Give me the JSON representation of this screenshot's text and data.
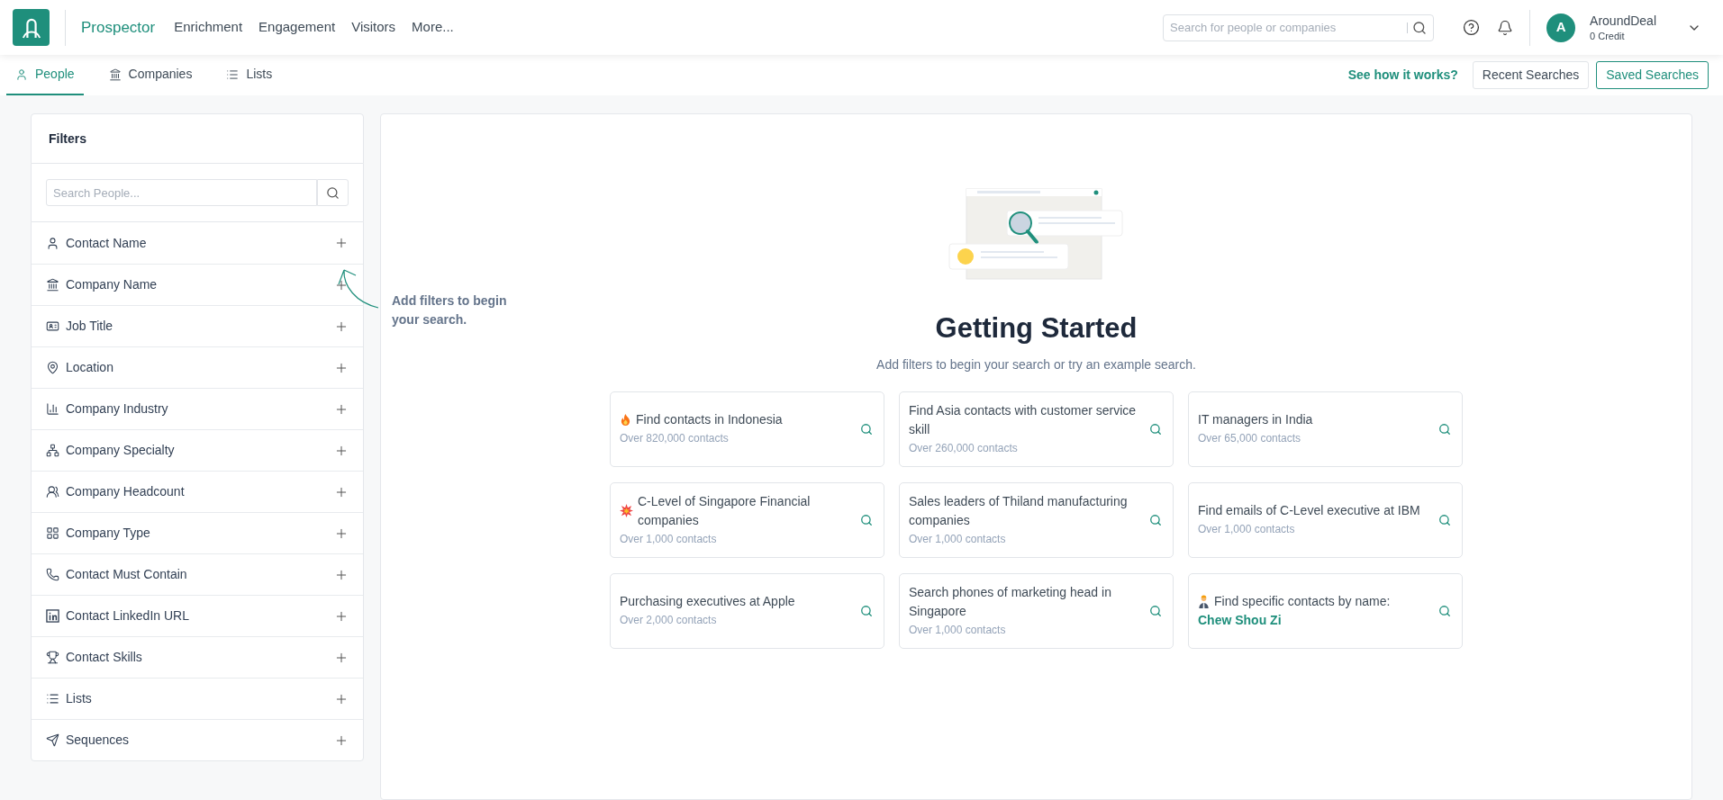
{
  "header": {
    "nav": [
      {
        "label": "Prospector",
        "selected": true
      },
      {
        "label": "Enrichment",
        "selected": false
      },
      {
        "label": "Engagement",
        "selected": false
      },
      {
        "label": "Visitors",
        "selected": false
      },
      {
        "label": "More...",
        "selected": false
      }
    ],
    "search": {
      "placeholder": "Search for people or companies"
    },
    "user": {
      "initial": "A",
      "name": "AroundDeal",
      "credits": "0 Credit"
    }
  },
  "tabs": [
    {
      "label": "People",
      "kind": "person",
      "selected": true
    },
    {
      "label": "Companies",
      "kind": "bank",
      "selected": false
    },
    {
      "label": "Lists",
      "kind": "list",
      "selected": false
    }
  ],
  "toolbar": {
    "help_link": "See how it works?",
    "buttons": [
      {
        "label": "Recent Searches",
        "selected": false
      },
      {
        "label": "Saved Searches",
        "selected": true
      }
    ]
  },
  "filters": {
    "title": "Filters",
    "search": {
      "placeholder": "Search People..."
    },
    "items": [
      {
        "label": "Contact Name",
        "kind": "person"
      },
      {
        "label": "Company Name",
        "kind": "bank"
      },
      {
        "label": "Job Title",
        "kind": "idcard"
      },
      {
        "label": "Location",
        "kind": "pin"
      },
      {
        "label": "Company Industry",
        "kind": "chart"
      },
      {
        "label": "Company Specialty",
        "kind": "hierarchy"
      },
      {
        "label": "Company Headcount",
        "kind": "people"
      },
      {
        "label": "Company Type",
        "kind": "grid"
      },
      {
        "label": "Contact Must Contain",
        "kind": "phone"
      },
      {
        "label": "Contact LinkedIn URL",
        "kind": "linkedin"
      },
      {
        "label": "Contact Skills",
        "kind": "trophy"
      },
      {
        "label": "Lists",
        "kind": "list"
      },
      {
        "label": "Sequences",
        "kind": "send"
      }
    ]
  },
  "hint": "Add filters to begin your search.",
  "main": {
    "title": "Getting Started",
    "subtitle": "Add filters to begin your search or try an example search.",
    "examples": [
      {
        "title": "Find contacts in Indonesia",
        "kind": "fire",
        "count": "Over 820,000 contacts"
      },
      {
        "title": "Find Asia contacts with customer service skill",
        "kind": "plain",
        "count": "Over 260,000 contacts"
      },
      {
        "title": "IT managers in India",
        "kind": "plain",
        "count": "Over 65,000 contacts"
      },
      {
        "title": "C-Level of Singapore Financial companies",
        "kind": "burst",
        "count": "Over 1,000 contacts"
      },
      {
        "title": "Sales leaders of Thiland manufacturing companies",
        "kind": "plain",
        "count": "Over 1,000 contacts"
      },
      {
        "title": "Find emails of C-Level executive at IBM",
        "kind": "plain",
        "count": "Over 1,000 contacts"
      },
      {
        "title": "Purchasing executives at Apple",
        "kind": "plain",
        "count": "Over 2,000 contacts"
      },
      {
        "title": "Search phones of marketing head in Singapore",
        "kind": "plain",
        "count": "Over 1,000 contacts"
      },
      {
        "title": "Find specific contacts by name:",
        "kind": "worker",
        "name": "Chew Shou Zi"
      }
    ]
  }
}
